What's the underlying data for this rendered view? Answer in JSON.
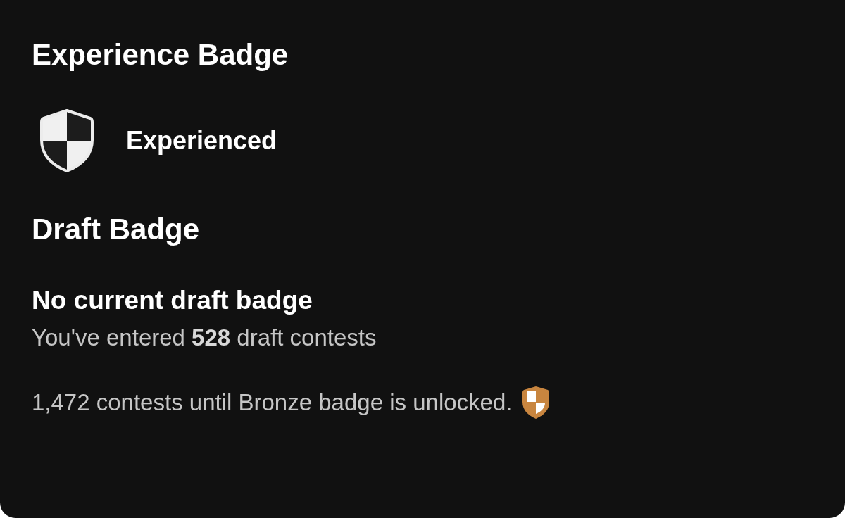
{
  "experience_section": {
    "title": "Experience Badge",
    "badge_label": "Experienced"
  },
  "draft_section": {
    "title": "Draft Badge",
    "status": "No current draft badge",
    "entered_text": "You've entered **528** draft contests",
    "unlock_text": "1,472 contests until Bronze badge is unlocked."
  }
}
